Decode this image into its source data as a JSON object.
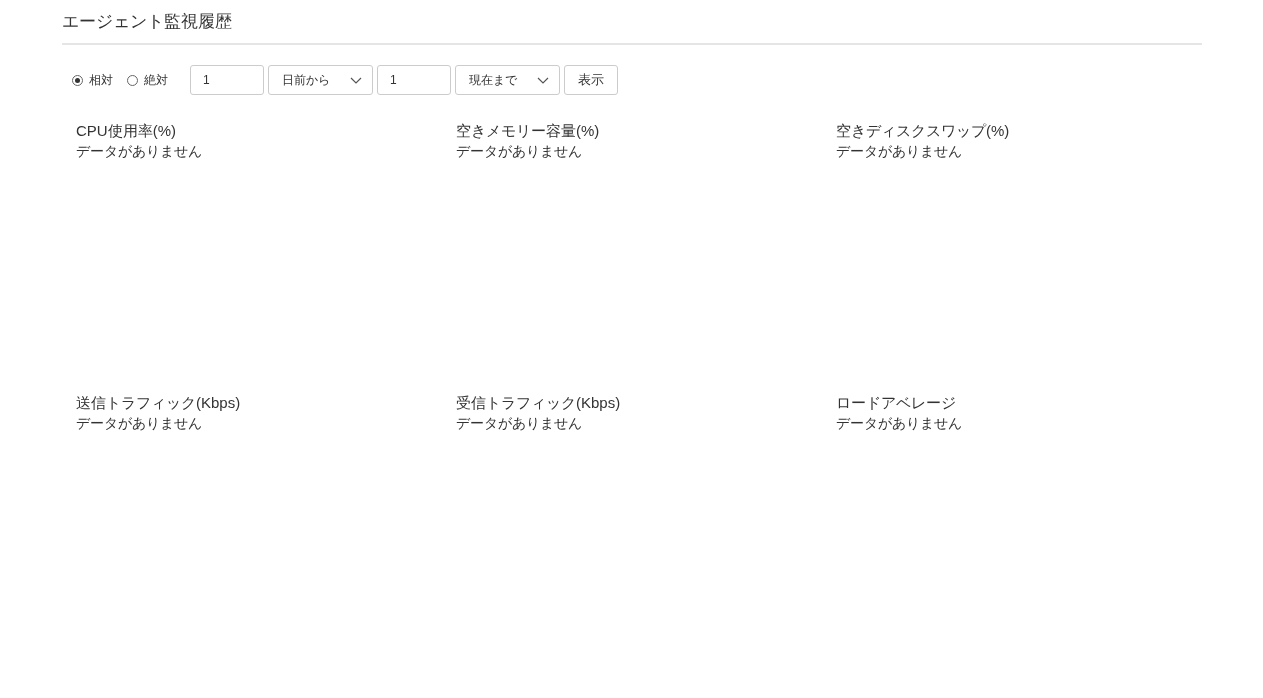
{
  "page": {
    "title": "エージェント監視履歴"
  },
  "range_modes": [
    {
      "label": "相対",
      "selected": true
    },
    {
      "label": "絶対",
      "selected": false
    }
  ],
  "controls": [
    {
      "kind": "input",
      "value": "1"
    },
    {
      "kind": "select",
      "value": "日前から"
    },
    {
      "kind": "input",
      "value": "1"
    },
    {
      "kind": "select",
      "value": "現在まで"
    },
    {
      "kind": "button",
      "label": "表示"
    }
  ],
  "panels": [
    {
      "title": "CPU使用率(%)",
      "message": "データがありません"
    },
    {
      "title": "空きメモリー容量(%)",
      "message": "データがありません"
    },
    {
      "title": "空きディスクスワップ(%)",
      "message": "データがありません"
    },
    {
      "title": "送信トラフィック(Kbps)",
      "message": "データがありません"
    },
    {
      "title": "受信トラフィック(Kbps)",
      "message": "データがありません"
    },
    {
      "title": "ロードアベレージ",
      "message": "データがありません"
    }
  ]
}
